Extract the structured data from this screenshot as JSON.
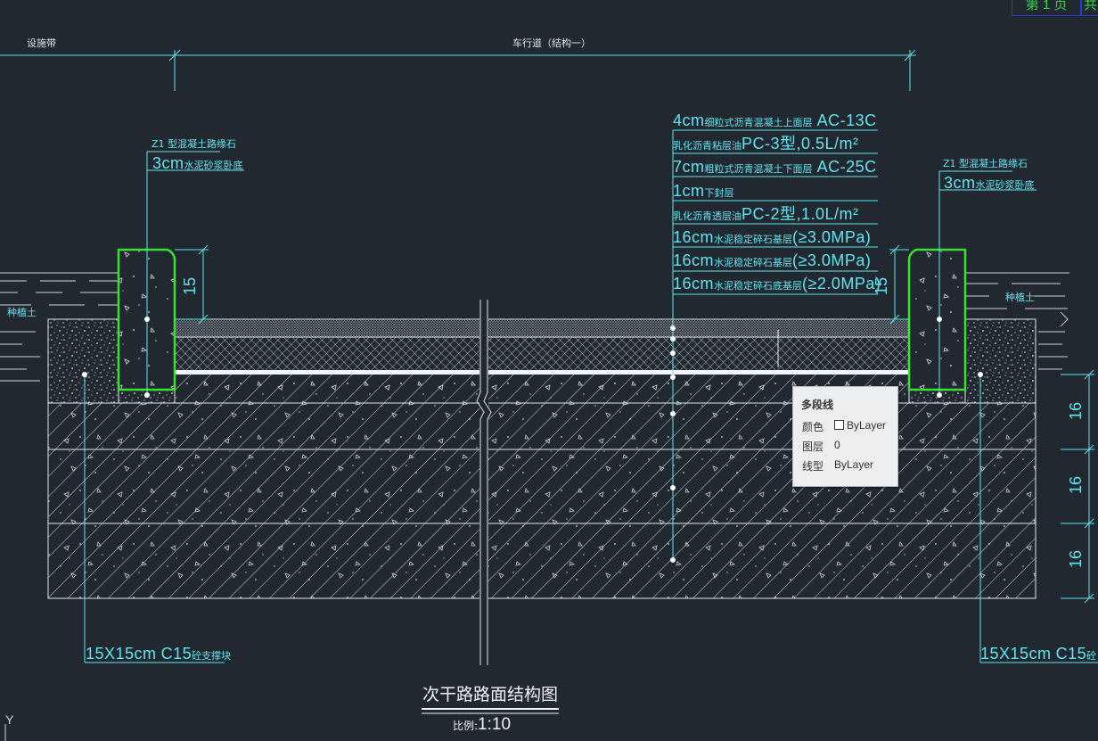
{
  "header": {
    "left_label": "设施带",
    "center_label": "车行道（结构一）"
  },
  "layers": [
    {
      "thick": "4cm",
      "desc": "细粒式沥青混凝土上面层",
      "spec": "AC-13C"
    },
    {
      "thick": "",
      "desc": "乳化沥青粘层油",
      "spec": "PC-3型,0.5L/m²"
    },
    {
      "thick": "7cm",
      "desc": "粗粒式沥青混凝土下面层",
      "spec": "AC-25C"
    },
    {
      "thick": "1cm",
      "desc": "下封层",
      "spec": ""
    },
    {
      "thick": "",
      "desc": "乳化沥青透层油",
      "spec": "PC-2型,1.0L/m²"
    },
    {
      "thick": "16cm",
      "desc": "水泥稳定碎石基层",
      "spec": "(≥3.0MPa)"
    },
    {
      "thick": "16cm",
      "desc": "水泥稳定碎石基层",
      "spec": "(≥3.0MPa)"
    },
    {
      "thick": "16cm",
      "desc": "水泥稳定碎石底基层",
      "spec": "(≥2.0MPa)"
    }
  ],
  "curb_left": {
    "title": "Z1 型混凝土路缘石",
    "bedding_thick": "3cm",
    "bedding_desc": "水泥砂浆卧底",
    "height": "15",
    "soil": "种植土"
  },
  "curb_right": {
    "title": "Z1 型混凝土路缘石",
    "bedding_thick": "3cm",
    "bedding_desc": "水泥砂浆卧底",
    "height": "15",
    "soil": "种植土"
  },
  "backing_left": {
    "size": "15X15cm",
    "grade": "C15",
    "desc": "砼支撑块"
  },
  "backing_right": {
    "size": "15X15cm",
    "grade": "C15",
    "desc": "砼"
  },
  "dims_right": [
    "16",
    "16",
    "16"
  ],
  "drawing_title": "次干路路面结构图",
  "scale_label": "比例:",
  "scale_value": "1:10",
  "ucs_label": "Y",
  "tooltip": {
    "title": "多段线",
    "color_label": "颜色",
    "color_value": "ByLayer",
    "layer_label": "图层",
    "layer_value": "0",
    "linetype_label": "线型",
    "linetype_value": "ByLayer"
  },
  "pager": {
    "left": "第 1 页",
    "right": "共"
  },
  "colors": {
    "background": "#212830",
    "cyan": "#62e3f0",
    "curb_green": "#39e22d",
    "white": "#e8edf2"
  }
}
